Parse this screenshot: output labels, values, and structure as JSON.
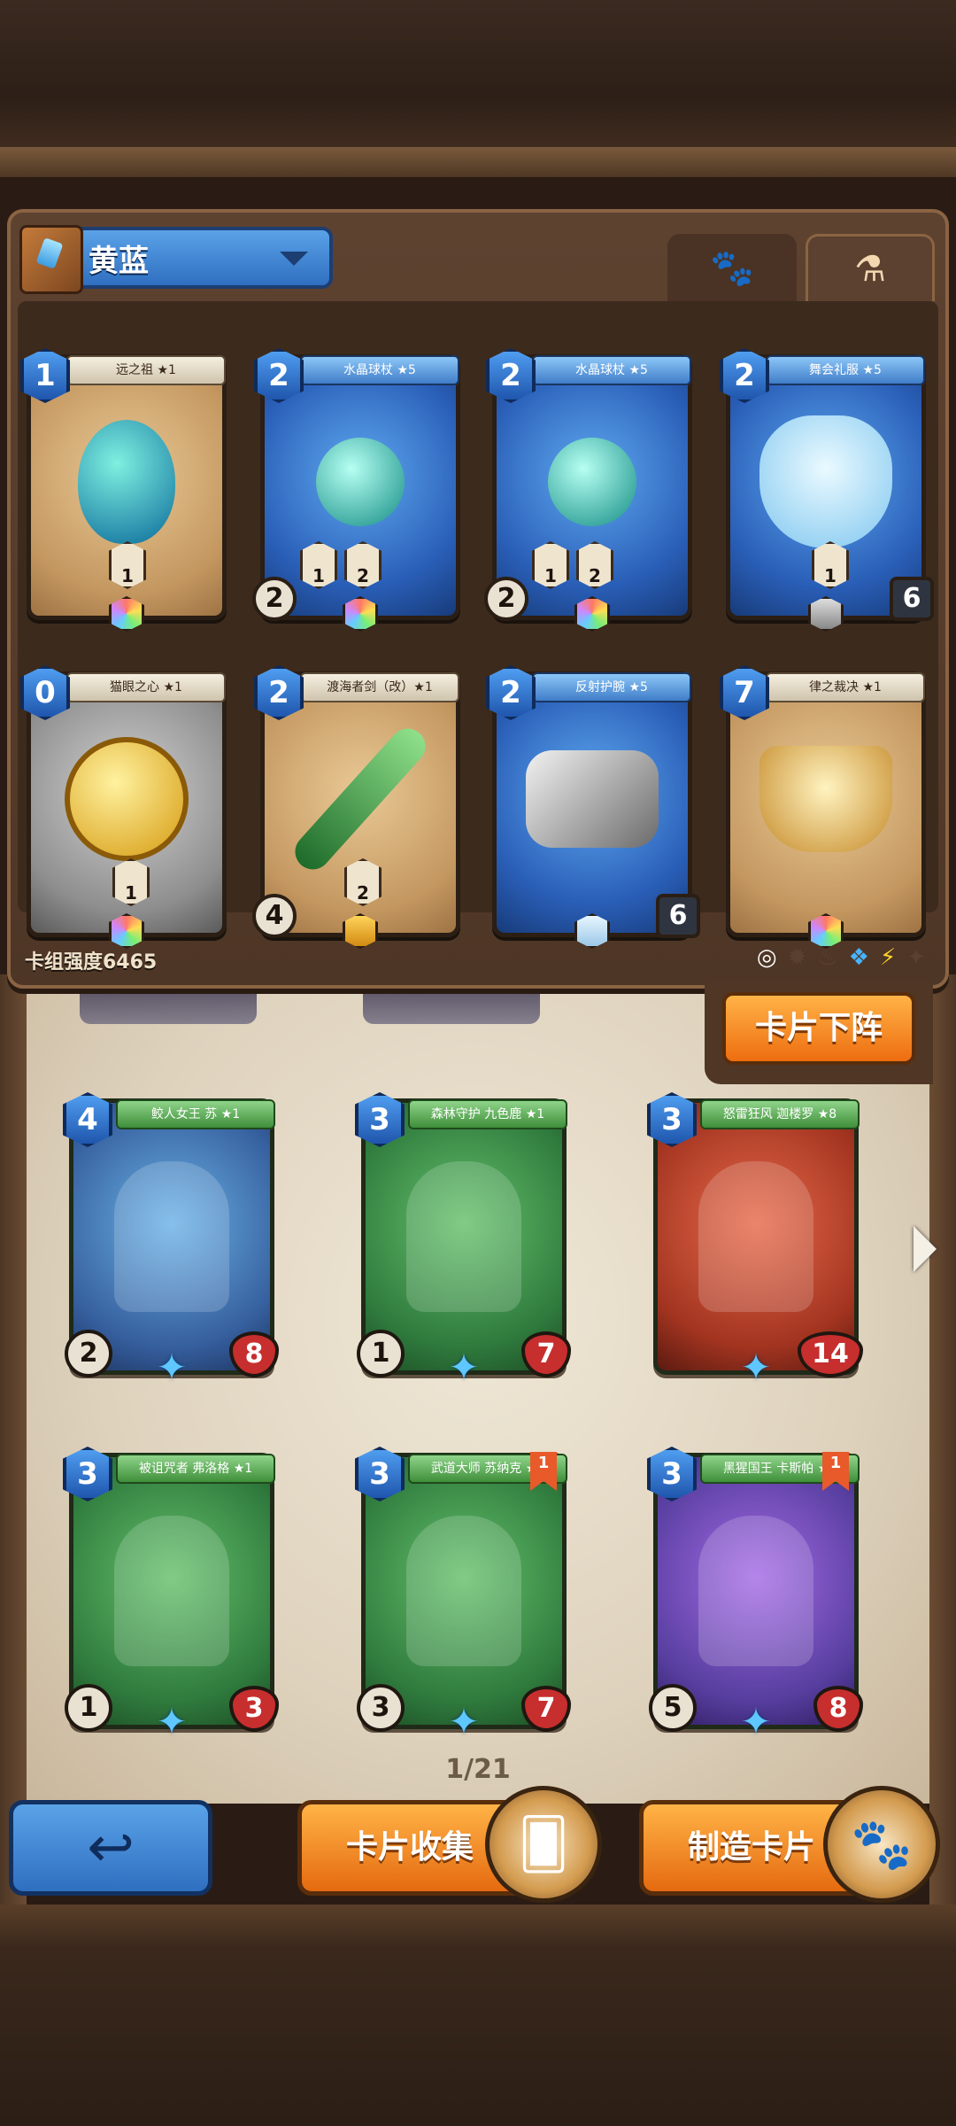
{
  "deck": {
    "name": "黄蓝",
    "strength_label": "卡组强度6465"
  },
  "tabs": {
    "paw": "🐾",
    "potion": "⚗"
  },
  "deck_cards": [
    {
      "cost": "1",
      "name": "远之祖 ★1",
      "style": "tan",
      "stat_l": "",
      "stat_r": "",
      "mini": [
        "",
        "1"
      ]
    },
    {
      "cost": "2",
      "name": "水晶球杖 ★5",
      "style": "blue",
      "stat_l": "2",
      "stat_r": "",
      "mini": [
        "1",
        "2"
      ]
    },
    {
      "cost": "2",
      "name": "水晶球杖 ★5",
      "style": "blue",
      "stat_l": "2",
      "stat_r": "",
      "mini": [
        "1",
        "2"
      ]
    },
    {
      "cost": "2",
      "name": "舞会礼服 ★5",
      "style": "blue",
      "stat_l": "",
      "stat_r": "6",
      "mini": [
        "1"
      ]
    },
    {
      "cost": "0",
      "name": "猫眼之心 ★1",
      "style": "gray",
      "stat_l": "",
      "stat_r": "",
      "mini": [
        "1"
      ]
    },
    {
      "cost": "2",
      "name": "渡海者剑（改）★1",
      "style": "tan",
      "stat_l": "4",
      "stat_r": "",
      "mini": [
        "2"
      ]
    },
    {
      "cost": "2",
      "name": "反射护腕 ★5",
      "style": "blue",
      "stat_l": "",
      "stat_r": "6",
      "mini": [
        ""
      ]
    },
    {
      "cost": "7",
      "name": "律之裁决 ★1",
      "style": "tan",
      "stat_l": "",
      "stat_r": "",
      "mini": [
        ""
      ]
    }
  ],
  "remove_button": "卡片下阵",
  "collection_cards": [
    {
      "cost": "4",
      "name": "鲛人女王 苏 ★1",
      "style": "teal",
      "atk": "2",
      "hp": "8",
      "extra": "1"
    },
    {
      "cost": "3",
      "name": "森林守护 九色鹿 ★1",
      "style": "green",
      "atk": "1",
      "hp": "7",
      "extra": ""
    },
    {
      "cost": "3",
      "name": "怒雷狂风 迦楼罗 ★8",
      "style": "red",
      "atk": "",
      "hp": "14",
      "extra": ""
    },
    {
      "cost": "3",
      "name": "被诅咒者 弗洛格 ★1",
      "style": "green",
      "atk": "1",
      "hp": "3",
      "extra": ""
    },
    {
      "cost": "3",
      "name": "武道大师 苏纳克 ★8",
      "style": "green",
      "atk": "3",
      "hp": "7",
      "extra": "4",
      "flag": "1"
    },
    {
      "cost": "3",
      "name": "黑猩国王 卡斯帕 ★8",
      "style": "purple",
      "atk": "5",
      "hp": "8",
      "extra": "4",
      "flag": "1"
    }
  ],
  "page": "1/21",
  "buttons": {
    "collect": "卡片收集",
    "craft": "制造卡片",
    "back": "↩"
  }
}
